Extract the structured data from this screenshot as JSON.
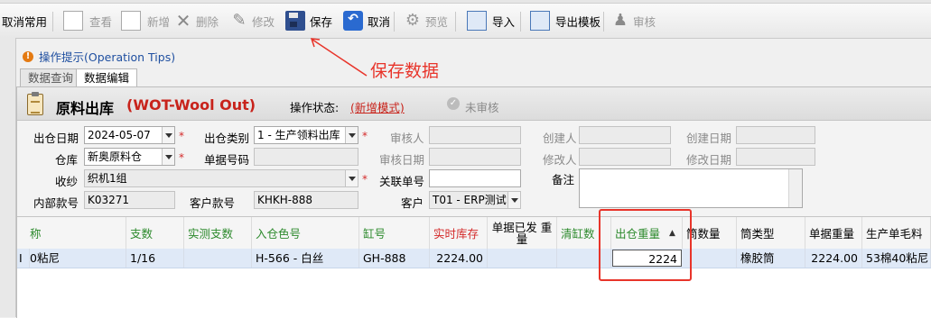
{
  "toolbar": {
    "cancel_common": "取消常用",
    "view": "查看",
    "new": "新增",
    "delete": "删除",
    "modify": "修改",
    "save": "保存",
    "cancel": "取消",
    "preview": "预览",
    "import": "导入",
    "export_template": "导出模板",
    "review": "审核"
  },
  "tips": {
    "label": "操作提示(Operation Tips)"
  },
  "annotation": "保存数据",
  "tabs": {
    "query": "数据查询",
    "edit": "数据编辑"
  },
  "form_header": {
    "title": "原料出库",
    "subtitle": "(WOT-Wool Out)",
    "op_status_label": "操作状态:",
    "op_status_value": "(新增模式)",
    "review_status": "未审核"
  },
  "form": {
    "out_date": {
      "label": "出仓日期",
      "value": "2024-05-07"
    },
    "out_type": {
      "label": "出仓类别",
      "value": "1 - 生产领料出库"
    },
    "reviewer": {
      "label": "审核人",
      "value": ""
    },
    "creator": {
      "label": "创建人",
      "value": ""
    },
    "create_date": {
      "label": "创建日期",
      "value": ""
    },
    "warehouse": {
      "label": "仓库",
      "value": "新奥原料仓"
    },
    "doc_no": {
      "label": "单据号码",
      "value": ""
    },
    "review_date": {
      "label": "审核日期",
      "value": ""
    },
    "modifier": {
      "label": "修改人",
      "value": ""
    },
    "modify_date": {
      "label": "修改日期",
      "value": ""
    },
    "receiver": {
      "label": "收纱",
      "value": "织机1组"
    },
    "related_doc": {
      "label": "关联单号",
      "value": ""
    },
    "remark": {
      "label": "备注",
      "value": ""
    },
    "internal_no": {
      "label": "内部款号",
      "value": "K03271"
    },
    "customer_no": {
      "label": "客户款号",
      "value": "KHKH-888"
    },
    "customer": {
      "label": "客户",
      "value": "T01 - ERP测试"
    }
  },
  "grid": {
    "columns": [
      "称",
      "支数",
      "实测支数",
      "入仓色号",
      "缸号",
      "实时库存",
      "单据已发 重量",
      "清缸数",
      "出仓重量",
      "筒数量",
      "筒类型",
      "单据重量",
      "生产单毛料"
    ],
    "rows": [
      {
        "marker": "I",
        "name": "0粘尼",
        "count": "1/16",
        "measured": "",
        "color_no": "H-566 - 白丝",
        "vat_no": "GH-888",
        "stock": "2224.00",
        "issued": "",
        "clear": "",
        "out_weight": "2224",
        "tube_qty": "",
        "tube_type": "橡胶筒",
        "doc_weight": "2224.00",
        "prod_material": "53棉40粘尼"
      }
    ]
  },
  "colors": {
    "accent_red": "#e8342a",
    "title_red": "#c8231b",
    "link_blue": "#1f4fa0",
    "row_select": "#dfe9f7"
  }
}
